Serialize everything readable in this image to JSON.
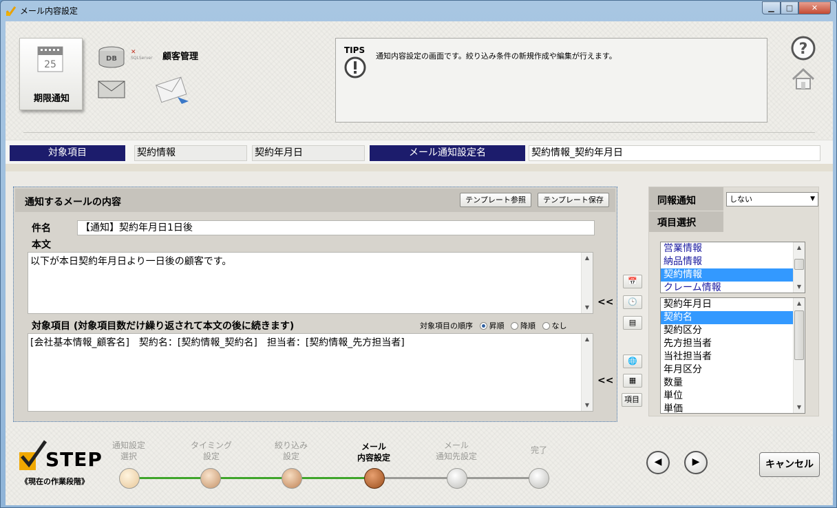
{
  "window": {
    "title": "メール内容設定"
  },
  "header": {
    "calendar_day": "25",
    "calendar_label": "期限通知",
    "db_icon_text": "DB",
    "sql_logo": "SQLServer",
    "customer_label": "顧客管理",
    "tips": {
      "title": "TIPS",
      "text": "通知内容設定の画面です。絞り込み条件の新規作成や編集が行えます。"
    }
  },
  "info": {
    "target_label": "対象項目",
    "target_value1": "契約情報",
    "target_value2": "契約年月日",
    "setting_name_label": "メール通知設定名",
    "setting_name_value": "契約情報_契約年月日"
  },
  "mail": {
    "title": "通知するメールの内容",
    "template_ref_button": "テンプレート参照",
    "template_save_button": "テンプレート保存",
    "subject_label": "件名",
    "subject_value": "【通知】契約年月日1日後",
    "body_label": "本文",
    "body_value": "以下が本日契約年月日より一日後の顧客です。",
    "items_label": "対象項目 (対象項目数だけ繰り返されて本文の後に続きます)",
    "order_label": "対象項目の順序",
    "order_options": [
      "昇順",
      "降順",
      "なし"
    ],
    "order_selected": "昇順",
    "items_value": "[会社基本情報_顧客名]　契約名：[契約情報_契約名]　担当者：[契約情報_先方担当者]",
    "insert_arrow": "<<",
    "item_button": "項目"
  },
  "right": {
    "cc_label": "同報通知",
    "cc_value": "しない",
    "item_select_label": "項目選択",
    "categories": [
      "営業情報",
      "納品情報",
      "契約情報",
      "クレーム情報"
    ],
    "category_selected": "契約情報",
    "fields": [
      "契約年月日",
      "契約名",
      "契約区分",
      "先方担当者",
      "当社担当者",
      "年月区分",
      "数量",
      "単位",
      "単価"
    ],
    "field_selected": "契約名"
  },
  "steps": {
    "logo_text": "STEP",
    "subtitle": "《現在の作業段階》",
    "items": [
      {
        "line1": "通知設定",
        "line2": "選択"
      },
      {
        "line1": "タイミング",
        "line2": "設定"
      },
      {
        "line1": "絞り込み",
        "line2": "設定"
      },
      {
        "line1": "メール",
        "line2": "内容設定"
      },
      {
        "line1": "メール",
        "line2": "通知先設定"
      },
      {
        "line1": "完了",
        "line2": ""
      }
    ],
    "current_index": 3,
    "cancel_button": "キャンセル"
  },
  "colors": {
    "navy": "#1c1c6c",
    "selection": "#3399ff",
    "step_done": "#e7c79a",
    "step_current": "#b3662e",
    "step_line_done": "#3fa52a"
  }
}
